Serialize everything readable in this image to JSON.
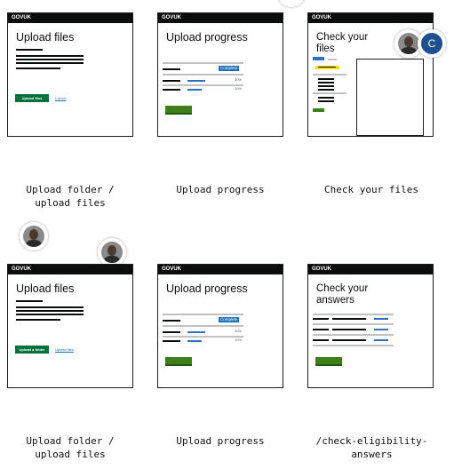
{
  "brand": "GOVUK",
  "cards": {
    "upload_files_1": {
      "title": "Upload files",
      "button": "Upload files",
      "link": "Cancel"
    },
    "upload_progress_1": {
      "title": "Upload progress",
      "tag": "Complete",
      "pct1": "30%",
      "pct2": "10%"
    },
    "check_files": {
      "title": "Check your files"
    },
    "upload_files_2": {
      "title": "Upload files",
      "button": "Upload a folder",
      "link": "Upload files"
    },
    "upload_progress_2": {
      "title": "Upload progress",
      "tag": "Complete",
      "pct1": "30%",
      "pct2": "10%"
    },
    "check_answers": {
      "title": "Check your answers"
    }
  },
  "captions": {
    "c1": "Upload folder / upload files",
    "c2": "Upload progress",
    "c3": "Check your files",
    "c4": "Upload folder / upload files",
    "c5": "Upload progress",
    "c6": "/check-eligibility-answers"
  },
  "avatar_initial": "C",
  "colors": {
    "header": "#0b0c0c",
    "button_green": "#00703c",
    "link_blue": "#1d70b8",
    "tag_blue": "#1d70b8",
    "highlight": "#ffdd00"
  }
}
